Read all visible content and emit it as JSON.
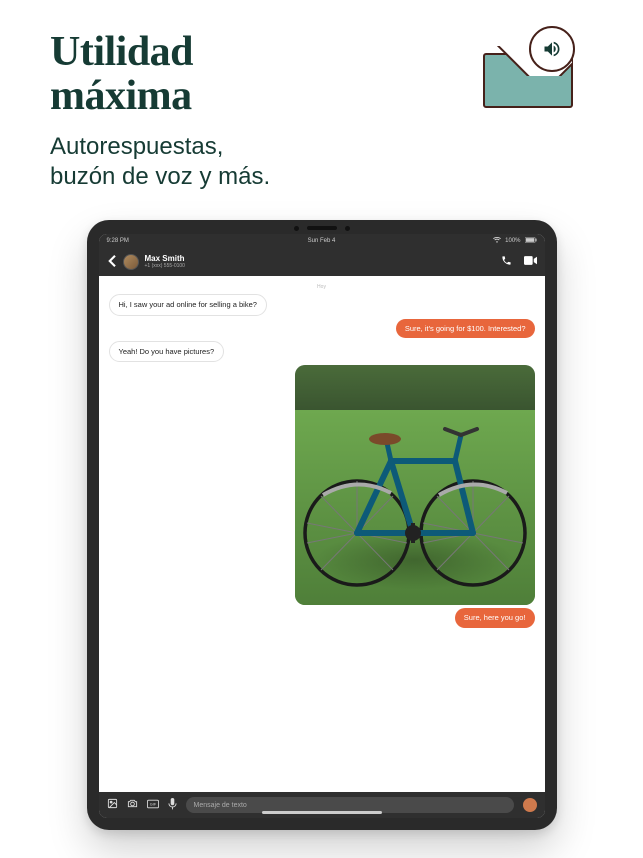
{
  "hero": {
    "title_line1": "Utilidad",
    "title_line2": "máxima",
    "subtitle_line1": "Autorespuestas,",
    "subtitle_line2": "buzón de voz y más."
  },
  "status": {
    "time": "9:28 PM",
    "date": "Sun Feb 4",
    "battery": "100%"
  },
  "contact": {
    "name": "Max Smith",
    "phone": "+1 (xxx) 555-0100"
  },
  "chat": {
    "day_label": "Hoy",
    "msg1": "Hi, I saw your ad online for selling a bike?",
    "msg2": "Sure, it's going for $100. Interested?",
    "msg3": "Yeah! Do you have pictures?",
    "msg4": "Sure, here you go!"
  },
  "input": {
    "placeholder": "Mensaje de texto"
  },
  "icons": {
    "speaker": "speaker-icon",
    "envelope": "envelope-icon",
    "back": "chevron-left-icon",
    "phone": "phone-icon",
    "video": "video-icon",
    "photo": "photo-icon",
    "camera": "camera-icon",
    "gif": "gif-icon",
    "mic": "microphone-icon",
    "send": "send-icon"
  }
}
